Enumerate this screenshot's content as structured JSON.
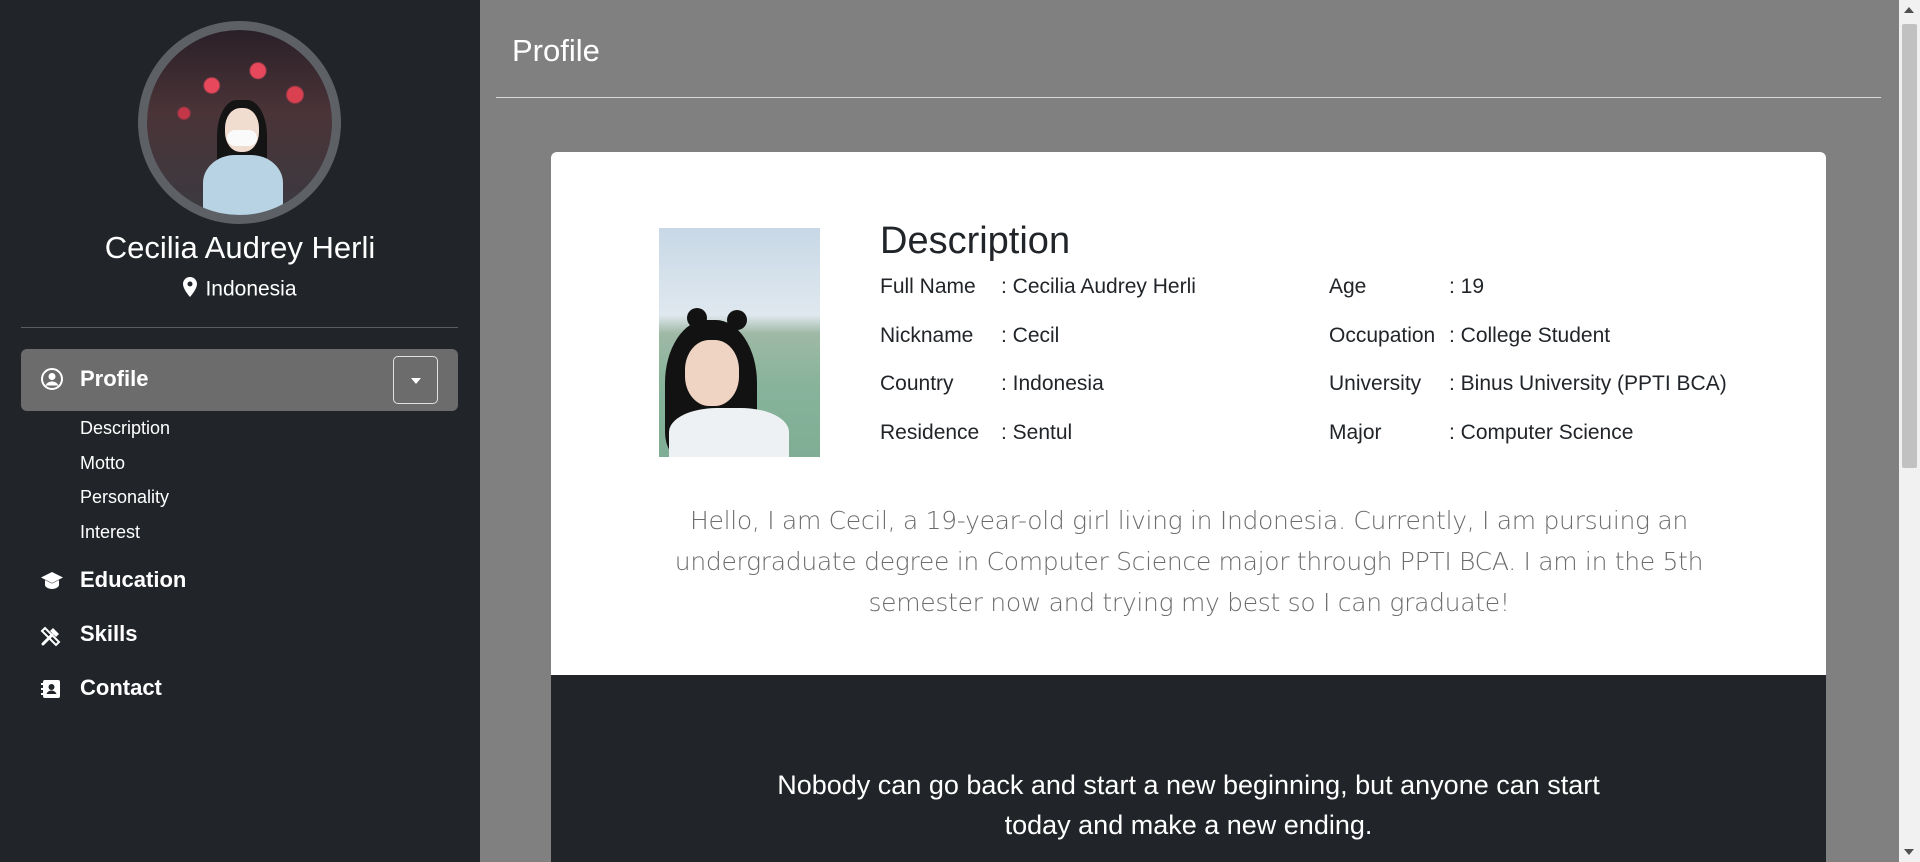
{
  "sidebar": {
    "user_name": "Cecilia Audrey Herli",
    "location": "Indonesia",
    "nav_profile": {
      "label": "Profile",
      "icon": "user-circle-icon"
    },
    "sub_items": [
      "Description",
      "Motto",
      "Personality",
      "Interest"
    ],
    "nav_items": [
      {
        "label": "Education",
        "icon": "graduation-cap-icon"
      },
      {
        "label": "Skills",
        "icon": "tools-icon"
      },
      {
        "label": "Contact",
        "icon": "contact-card-icon"
      }
    ]
  },
  "main": {
    "header": "Profile",
    "description": {
      "title": "Description",
      "left_fields": [
        {
          "label": "Full Name",
          "value": ": Cecilia Audrey Herli"
        },
        {
          "label": "Nickname",
          "value": ": Cecil"
        },
        {
          "label": "Country",
          "value": ": Indonesia"
        },
        {
          "label": "Residence",
          "value": ": Sentul"
        }
      ],
      "right_fields": [
        {
          "label": "Age",
          "value": ": 19"
        },
        {
          "label": "Occupation",
          "value": ": College Student"
        },
        {
          "label": "University",
          "value": ": Binus University (PPTI BCA)"
        },
        {
          "label": "Major",
          "value": ": Computer Science"
        }
      ],
      "bio": "Hello, I am Cecil, a 19-year-old girl living in Indonesia. Currently, I am pursuing an undergraduate degree in Computer Science major through PPTI BCA. I am in the 5th semester now and trying my best so I can graduate!"
    },
    "motto": "Nobody can go back and start a new beginning, but anyone can start today and make a new ending."
  },
  "colors": {
    "sidebar_bg": "#212529",
    "page_bg": "#808080",
    "active_nav_bg": "#6c6c6c",
    "card_bg": "#ffffff",
    "motto_bg": "#212529"
  }
}
